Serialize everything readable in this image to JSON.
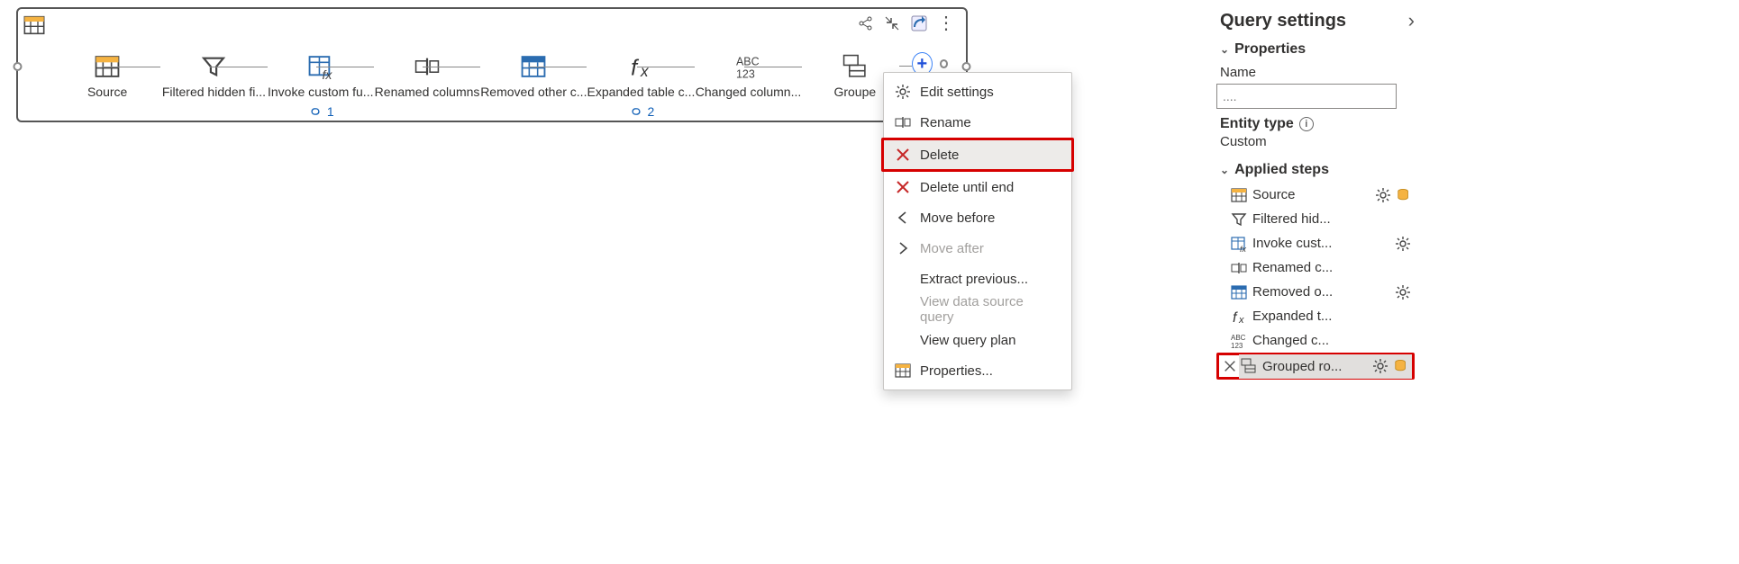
{
  "canvas": {
    "steps": [
      {
        "id": "source",
        "label": "Source",
        "icon": "table"
      },
      {
        "id": "filtered",
        "label": "Filtered hidden fi...",
        "icon": "funnel"
      },
      {
        "id": "invoke",
        "label": "Invoke custom fu...",
        "icon": "table-fx",
        "link_count": "1"
      },
      {
        "id": "renamed",
        "label": "Renamed columns",
        "icon": "rename"
      },
      {
        "id": "removed",
        "label": "Removed other c...",
        "icon": "table-blue"
      },
      {
        "id": "expanded",
        "label": "Expanded table c...",
        "icon": "fx",
        "link_count": "2"
      },
      {
        "id": "changed",
        "label": "Changed column...",
        "icon": "abc123"
      },
      {
        "id": "grouped",
        "label": "Groupe",
        "icon": "group"
      }
    ],
    "add_label": "+"
  },
  "context_menu": {
    "items": [
      {
        "id": "edit",
        "label": "Edit settings",
        "icon": "gear"
      },
      {
        "id": "rename",
        "label": "Rename",
        "icon": "rename"
      },
      {
        "id": "delete",
        "label": "Delete",
        "icon": "x-red",
        "highlight": true,
        "selected": true
      },
      {
        "id": "deluntil",
        "label": "Delete until end",
        "icon": "x-red"
      },
      {
        "id": "before",
        "label": "Move before",
        "icon": "chev-l"
      },
      {
        "id": "after",
        "label": "Move after",
        "icon": "chev-r",
        "disabled": true
      },
      {
        "id": "extract",
        "label": "Extract previous...",
        "icon": ""
      },
      {
        "id": "dsq",
        "label": "View data source query",
        "icon": "",
        "disabled": true
      },
      {
        "id": "plan",
        "label": "View query plan",
        "icon": ""
      },
      {
        "id": "props",
        "label": "Properties...",
        "icon": "table"
      }
    ]
  },
  "panel": {
    "title": "Query settings",
    "properties_label": "Properties",
    "name_label": "Name",
    "name_value": "",
    "name_placeholder": "....",
    "entity_type_label": "Entity type",
    "entity_type_value": "Custom",
    "applied_label": "Applied steps",
    "steps": [
      {
        "label": "Source",
        "icon": "table",
        "gear": true,
        "db": true
      },
      {
        "label": "Filtered hid...",
        "icon": "funnel",
        "gear": false,
        "db": false
      },
      {
        "label": "Invoke cust...",
        "icon": "table-fx",
        "gear": true,
        "db": false
      },
      {
        "label": "Renamed c...",
        "icon": "rename",
        "gear": false,
        "db": false
      },
      {
        "label": "Removed o...",
        "icon": "table-blue",
        "gear": true,
        "db": false
      },
      {
        "label": "Expanded t...",
        "icon": "fx",
        "gear": false,
        "db": false
      },
      {
        "label": "Changed c...",
        "icon": "abc123",
        "gear": false,
        "db": false
      },
      {
        "label": "Grouped ro...",
        "icon": "group",
        "gear": true,
        "db": true,
        "highlight": true
      }
    ]
  }
}
